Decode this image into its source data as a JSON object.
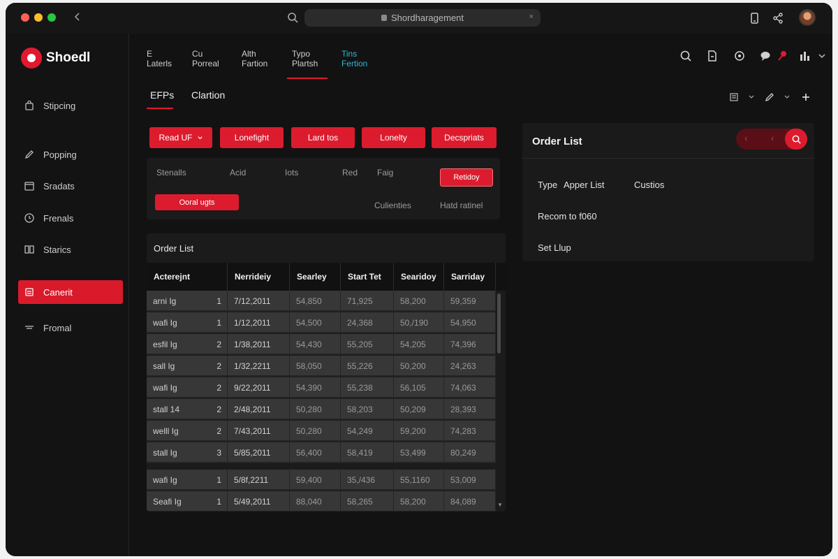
{
  "titlebar": {
    "url": "Shordharagement",
    "url_close": "×"
  },
  "brand": {
    "name": "Shoedl",
    "accent": "#dc1c2e"
  },
  "sidebar": {
    "items": [
      {
        "label": "Stipcing",
        "icon": "bag-icon"
      },
      {
        "label": "Popping",
        "icon": "edit-icon"
      },
      {
        "label": "Sradats",
        "icon": "calendar-icon"
      },
      {
        "label": "Frenals",
        "icon": "clock-icon"
      },
      {
        "label": "Starics",
        "icon": "document-icon"
      },
      {
        "label": "Canerit",
        "icon": "cart-icon",
        "active": true
      },
      {
        "label": "Fromal",
        "icon": "menu-icon"
      }
    ]
  },
  "topnav": {
    "tabs": [
      {
        "line1": "E",
        "line2": "Laterls"
      },
      {
        "line1": "Cu",
        "line2": "Porreal"
      },
      {
        "line1": "Alth",
        "line2": "Fartion"
      },
      {
        "line1": "Typo",
        "line2": "Plartsh",
        "active": true
      },
      {
        "line1": "Tins",
        "line2": "Fertion",
        "highlight": "#30b7d6"
      }
    ]
  },
  "subtabs": {
    "items": [
      "EFPs",
      "Clartion"
    ]
  },
  "filters": {
    "buttons": [
      "Read UF",
      "Lonefight",
      "Lard tos",
      "Lonelty",
      "Decspriats"
    ],
    "labels": [
      "Stenalls",
      "Acid",
      "Iots",
      "Red",
      "Faig"
    ],
    "ready_button": "Retidoy",
    "action_button": "Ooral ugts",
    "right_labels": [
      "Culienties",
      "Hatd ratinel"
    ]
  },
  "order_table": {
    "title": "Order List",
    "columns": [
      "Acterejnt",
      "Nerrideiy",
      "Searley",
      "Start Tet",
      "Searidoy",
      "Sarriday"
    ],
    "rows": [
      {
        "name": "arni Ig",
        "idx": "1",
        "date": "7/12,2011",
        "a": "54,850",
        "b": "71,925",
        "c": "58,200",
        "d": "59,359"
      },
      {
        "name": "wafi Ig",
        "idx": "1",
        "date": "1/12,2011",
        "a": "54,500",
        "b": "24,368",
        "c": "50,/190",
        "d": "54,950"
      },
      {
        "name": "esfil Ig",
        "idx": "2",
        "date": "1/38,2011",
        "a": "54,430",
        "b": "55,205",
        "c": "54,205",
        "d": "74,396"
      },
      {
        "name": "sall Ig",
        "idx": "2",
        "date": "1/32,2211",
        "a": "58,050",
        "b": "55,226",
        "c": "50,200",
        "d": "24,263"
      },
      {
        "name": "wafi Ig",
        "idx": "2",
        "date": "9/22,2011",
        "a": "54,390",
        "b": "55,238",
        "c": "56,105",
        "d": "74,063"
      },
      {
        "name": "stall 14",
        "idx": "2",
        "date": "2/48,2011",
        "a": "50,280",
        "b": "58,203",
        "c": "50,209",
        "d": "28,393"
      },
      {
        "name": "welll Ig",
        "idx": "2",
        "date": "7/43,2011",
        "a": "50,280",
        "b": "54,249",
        "c": "59,200",
        "d": "74,283"
      },
      {
        "name": "stall Ig",
        "idx": "3",
        "date": "5/85,2011",
        "a": "56,400",
        "b": "58,419",
        "c": "53,499",
        "d": "80,249"
      },
      {
        "name": "wafi Ig",
        "idx": "1",
        "date": "5/8f,2211",
        "a": "59,400",
        "b": "35,/436",
        "c": "55,1160",
        "d": "53,009"
      },
      {
        "name": "Seafi Ig",
        "idx": "1",
        "date": "5/49,2011",
        "a": "88,040",
        "b": "58,265",
        "c": "58,200",
        "d": "84,089"
      }
    ]
  },
  "right_panel": {
    "title": "Order List",
    "pager_prev": "‹",
    "pager_prev2": "‹",
    "type_label": "Type",
    "type_value": "Apper List",
    "custom_label": "Custios",
    "line2": "Recom to f060",
    "line3": "Set Llup"
  }
}
